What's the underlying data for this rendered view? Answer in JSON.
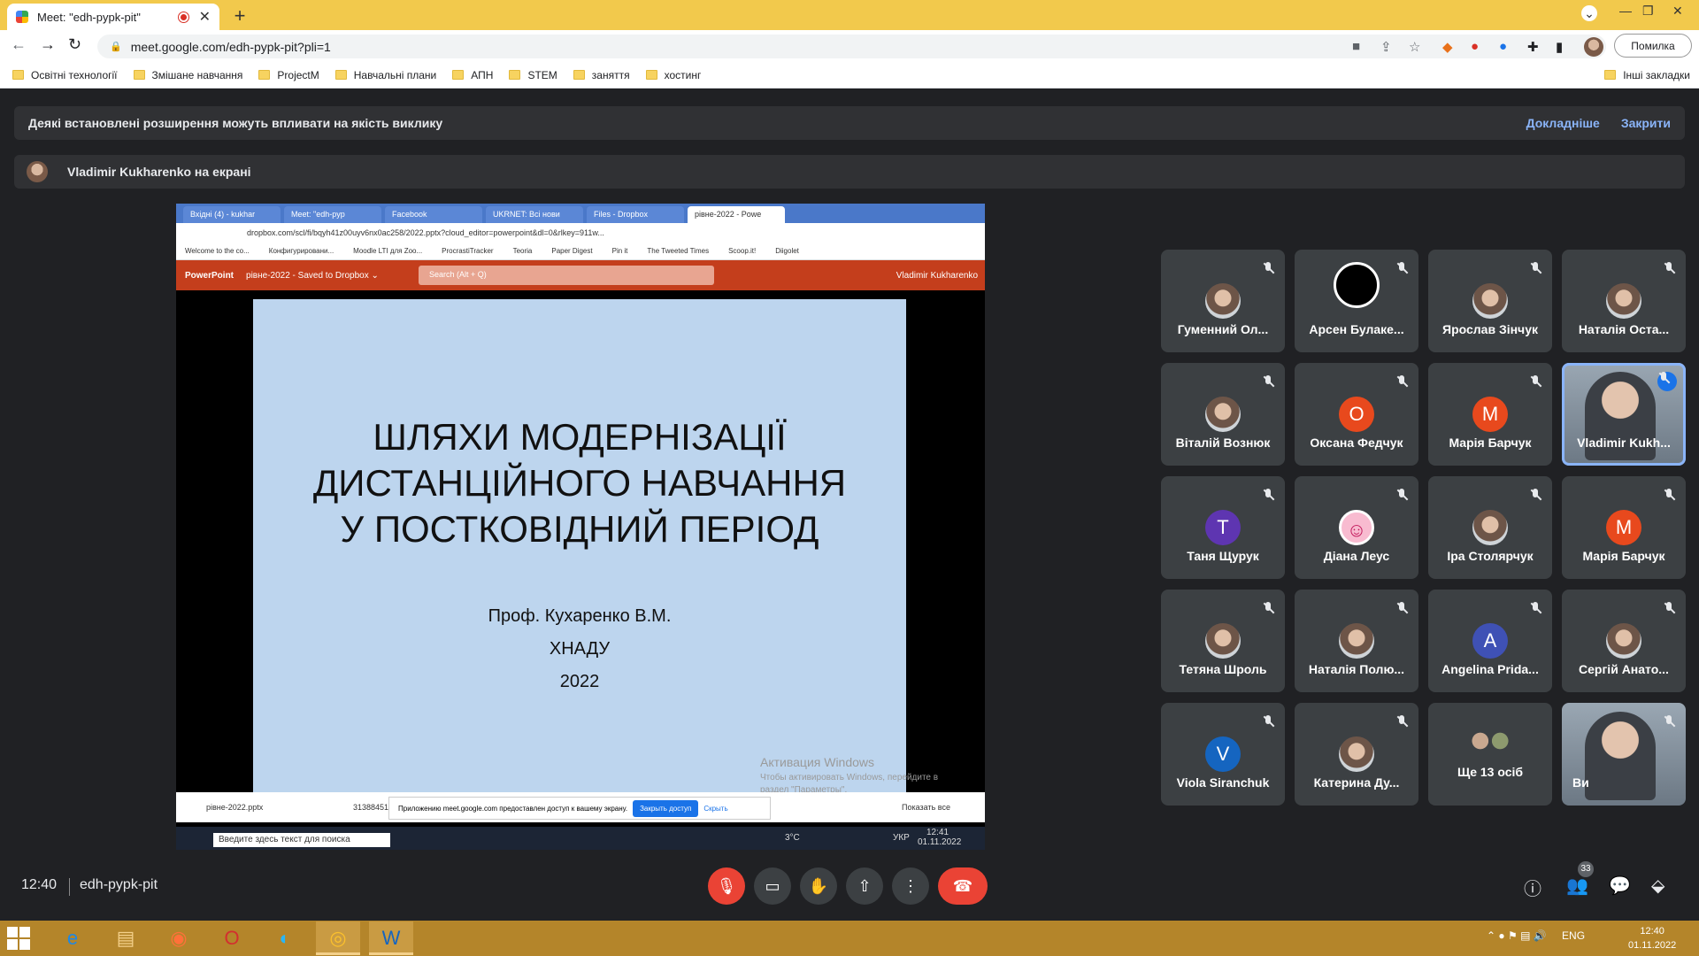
{
  "browser": {
    "tab_title": "Meet: \"edh-pypk-pit\"",
    "url": "meet.google.com/edh-pypk-pit?pli=1",
    "error_label": "Помилка",
    "bookmarks": [
      "Освітні технології",
      "Змішане навчання",
      "ProjectM",
      "Навчальні плани",
      "АПН",
      "STEM",
      "заняття",
      "хостинг"
    ],
    "other_bookmarks": "Інші закладки"
  },
  "meet": {
    "warning_text": "Деякі встановлені розширення можуть впливати на якість виклику",
    "warning_more": "Докладніше",
    "warning_close": "Закрити",
    "presenter_text": "Vladimir Kukharenko на екрані",
    "time": "12:40",
    "meeting_code": "edh-pypk-pit",
    "participants_count": "33"
  },
  "shared_screen": {
    "tabs": [
      "Вхідні (4) - kukhar",
      "Meet: \"edh-pyp",
      "Facebook",
      "UKRNET: Всі нови",
      "Files - Dropbox",
      "рівне-2022 - Powe"
    ],
    "url": "dropbox.com/scl/fi/bqyh41z00uyv6nx0ac258/2022.pptx?cloud_editor=powerpoint&dl=0&rlkey=911w...",
    "bookmarks": [
      "Welcome to the co...",
      "Конфигурировани...",
      "Moodle LTI для Zoo...",
      "ProcrastiTracker",
      "Teoria",
      "Paper Digest",
      "Pin it",
      "The Tweeted Times",
      "Scoop.it!",
      "Diigolet"
    ],
    "app_name": "PowerPoint",
    "doc_name": "рівне-2022 - Saved to Dropbox ⌄",
    "search_placeholder": "Search (Alt + Q)",
    "user": "Vladimir Kukharenko",
    "slide_title_1": "ШЛЯХИ МОДЕРНІЗАЦІЇ",
    "slide_title_2": "ДИСТАНЦІЙНОГО НАВЧАННЯ",
    "slide_title_3": "У ПОСТКОВІДНИЙ ПЕРІОД",
    "slide_author": "Проф. Кухаренко В.М.",
    "slide_org": "ХНАДУ",
    "slide_year": "2022",
    "activation_title": "Активация Windows",
    "activation_text": "Чтобы активировать Windows, перейдите в раздел \"Параметры\".",
    "download_file": "рівне-2022.pptx",
    "download_file2": "31388451",
    "share_notice": "Приложению meet.google.com предоставлен доступ к вашему экрану.",
    "share_stop": "Закрыть доступ",
    "share_hide": "Скрыть",
    "show_all": "Показать все",
    "taskbar_search": "Введите здесь текст для поиска",
    "temp": "3°C",
    "lang": "УКР",
    "time": "12:41",
    "date": "01.11.2022"
  },
  "participants": [
    {
      "name": "Гуменний Ол...",
      "kind": "photo"
    },
    {
      "name": "Арсен Булаке...",
      "kind": "obs"
    },
    {
      "name": "Ярослав Зінчук",
      "kind": "photo"
    },
    {
      "name": "Наталія Оста...",
      "kind": "photo"
    },
    {
      "name": "Віталій Вознюк",
      "kind": "photo"
    },
    {
      "name": "Оксана Федчук",
      "letter": "О",
      "color": "#e8491d"
    },
    {
      "name": "Марія Барчук",
      "letter": "М",
      "color": "#e8491d"
    },
    {
      "name": "Vladimir Kukh...",
      "kind": "video"
    },
    {
      "name": "Таня Щурук",
      "letter": "Т",
      "color": "#5e35b1"
    },
    {
      "name": "Діана Леус",
      "kind": "smile"
    },
    {
      "name": "Іра Столярчук",
      "kind": "photo"
    },
    {
      "name": "Марія Барчук",
      "letter": "М",
      "color": "#e8491d"
    },
    {
      "name": "Тетяна Шроль",
      "kind": "photo"
    },
    {
      "name": "Наталія Полю...",
      "kind": "photo"
    },
    {
      "name": "Angelina Prida...",
      "letter": "A",
      "color": "#3f51b5"
    },
    {
      "name": "Сергій Анато...",
      "kind": "photo"
    },
    {
      "name": "Viola Siranchuk",
      "letter": "V",
      "color": "#1565c0"
    },
    {
      "name": "Катерина Ду...",
      "kind": "photo"
    },
    {
      "name": "Ще 13 осіб",
      "kind": "more"
    },
    {
      "name": "Ви",
      "kind": "self"
    }
  ],
  "windows": {
    "lang": "ENG",
    "time": "12:40",
    "date": "01.11.2022"
  }
}
